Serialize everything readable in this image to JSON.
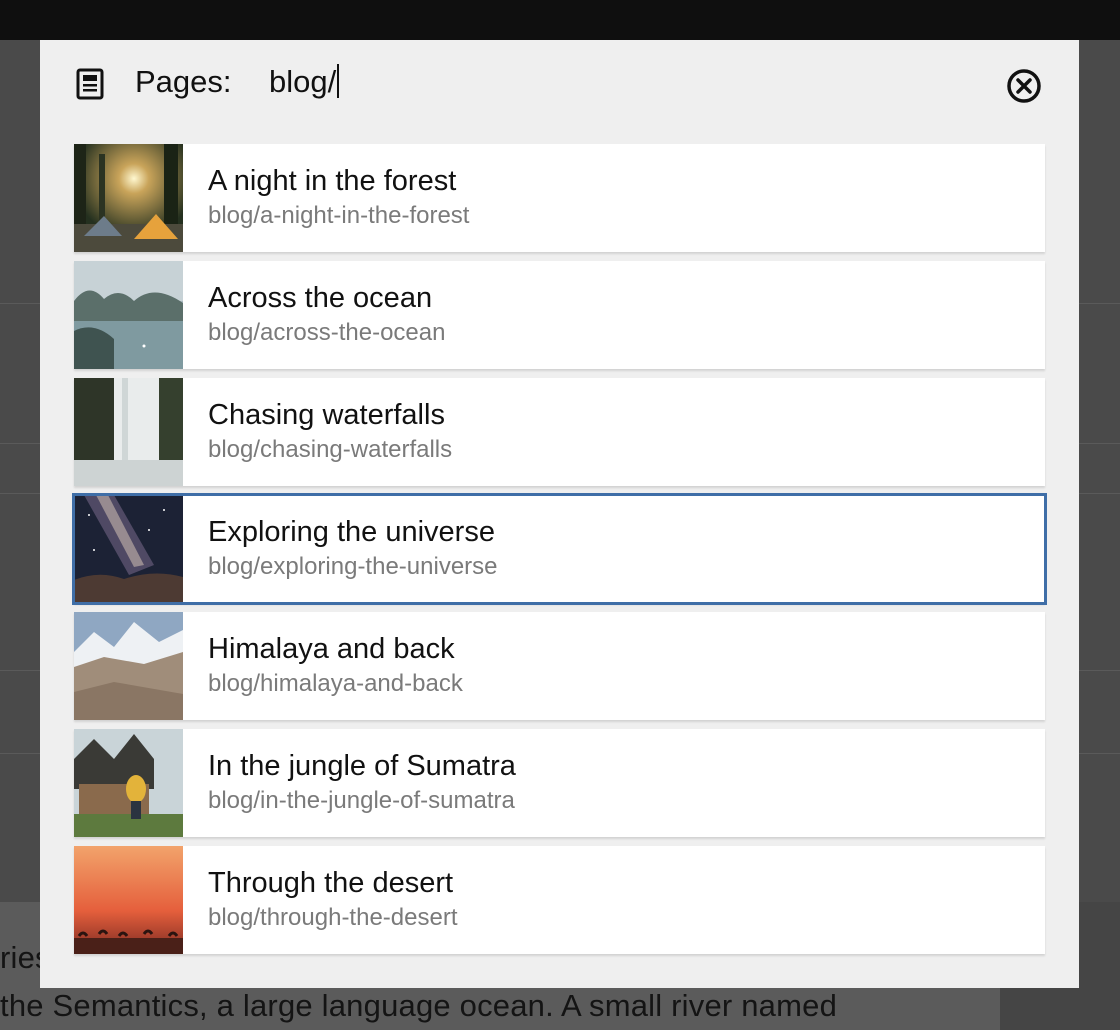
{
  "background": {
    "text_line_1": "ries",
    "text_line_2": "the Semantics, a large language ocean. A small river named"
  },
  "dialog": {
    "label": "Pages:",
    "query": "blog/",
    "icons": {
      "section": "page-icon",
      "close": "close-icon"
    }
  },
  "pages": [
    {
      "title": "A night in the forest",
      "slug": "blog/a-night-in-the-forest",
      "thumb": "forest-camp-image",
      "selected": false
    },
    {
      "title": "Across the ocean",
      "slug": "blog/across-the-ocean",
      "thumb": "ocean-bay-image",
      "selected": false
    },
    {
      "title": "Chasing waterfalls",
      "slug": "blog/chasing-waterfalls",
      "thumb": "waterfall-image",
      "selected": false
    },
    {
      "title": "Exploring the universe",
      "slug": "blog/exploring-the-universe",
      "thumb": "night-sky-image",
      "selected": true
    },
    {
      "title": "Himalaya and back",
      "slug": "blog/himalaya-and-back",
      "thumb": "mountains-image",
      "selected": false
    },
    {
      "title": "In the jungle of Sumatra",
      "slug": "blog/in-the-jungle-of-sumatra",
      "thumb": "jungle-house-image",
      "selected": false
    },
    {
      "title": "Through the desert",
      "slug": "blog/through-the-desert",
      "thumb": "desert-sunset-image",
      "selected": false
    }
  ],
  "colors": {
    "selection": "#3f6ea7",
    "dialog_bg": "#efefef"
  }
}
